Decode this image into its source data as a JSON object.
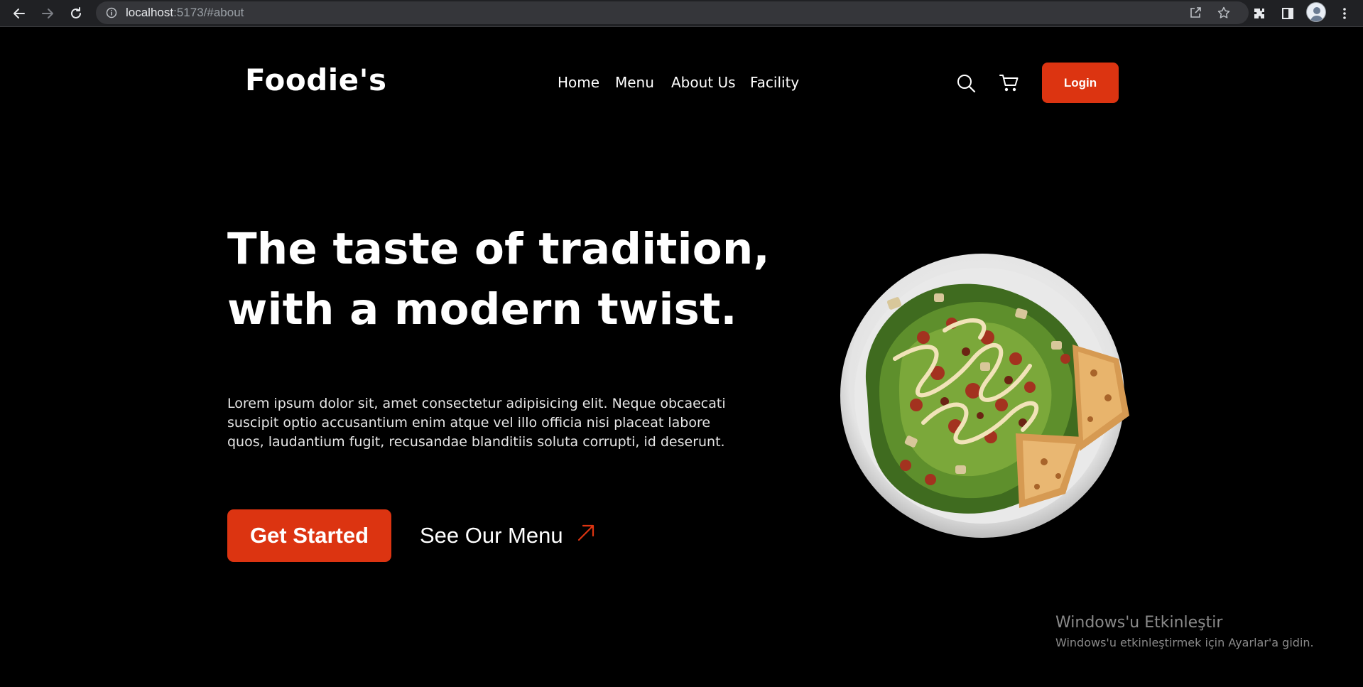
{
  "browser": {
    "url_host": "localhost",
    "url_rest": ":5173/#about",
    "icons": [
      "back-icon",
      "forward-icon",
      "reload-icon",
      "info-icon",
      "share-icon",
      "star-icon",
      "extensions-icon",
      "side-panel-icon",
      "profile-avatar",
      "kebab-menu-icon"
    ]
  },
  "site": {
    "logo": "Foodie's",
    "nav": [
      "Home",
      "Menu",
      "About Us",
      "Facility"
    ],
    "header_icons": [
      "search-icon",
      "cart-icon"
    ],
    "login_label": "Login"
  },
  "hero": {
    "headline_line1": "The taste of tradition,",
    "headline_line2": "with a modern twist.",
    "paragraph": "Lorem ipsum dolor sit, amet consectetur adipisicing elit. Neque obcaecati suscipit optio accusantium enim atque vel illo officia nisi placeat labore quos, laudantium fugit, recusandae blanditiis soluta corrupti, id deserunt.",
    "cta_label": "Get Started",
    "menu_link_label": "See Our Menu",
    "menu_link_icon": "arrow-up-right-icon",
    "image": "salad-plate-image"
  },
  "watermark": {
    "title": "Windows'u Etkinleştir",
    "subtitle": "Windows'u etkinleştirmek için Ayarlar'a gidin."
  },
  "colors": {
    "accent": "#dc3411",
    "background": "#000000",
    "chrome": "#202124",
    "omnibox": "#35363a"
  }
}
